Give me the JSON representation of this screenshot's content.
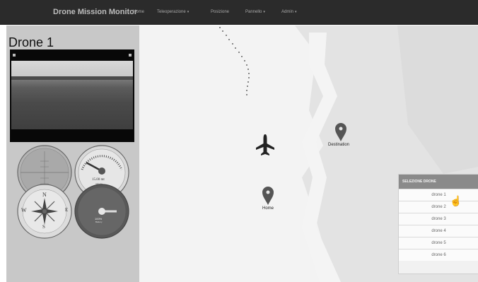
{
  "app": {
    "brand": "Drone Mission Monitor",
    "nav": [
      {
        "label": "Home",
        "caret": false
      },
      {
        "label": "Teleoperazione",
        "caret": true
      },
      {
        "label": "Posizione",
        "caret": false
      },
      {
        "label": "Pannello",
        "caret": true
      },
      {
        "label": "Admin",
        "caret": true
      }
    ]
  },
  "drone": {
    "title": "Drone 1"
  },
  "instruments": {
    "altimeter": {
      "value": "15.00 mt",
      "label": "Altitude"
    },
    "compass": {
      "north": "N",
      "east": "E",
      "south": "S",
      "west": "W"
    },
    "battery": {
      "value": "100%",
      "label": "Battery",
      "level": 1.0
    }
  },
  "map": {
    "markers": [
      {
        "label": "Destination"
      },
      {
        "label": "Home"
      }
    ]
  },
  "selection_panel": {
    "header": "SELEZIONE DRONE",
    "drones": [
      "drone 1",
      "drone 2",
      "drone 3",
      "drone 4",
      "drone 5",
      "drone 6"
    ]
  },
  "colors": {
    "navbar": "#2b2b2b",
    "sidebar": "#c8c8c8",
    "map_land": "#e3e3e3",
    "map_road": "#f2f2f2",
    "panel_header": "#8a8a8a"
  }
}
